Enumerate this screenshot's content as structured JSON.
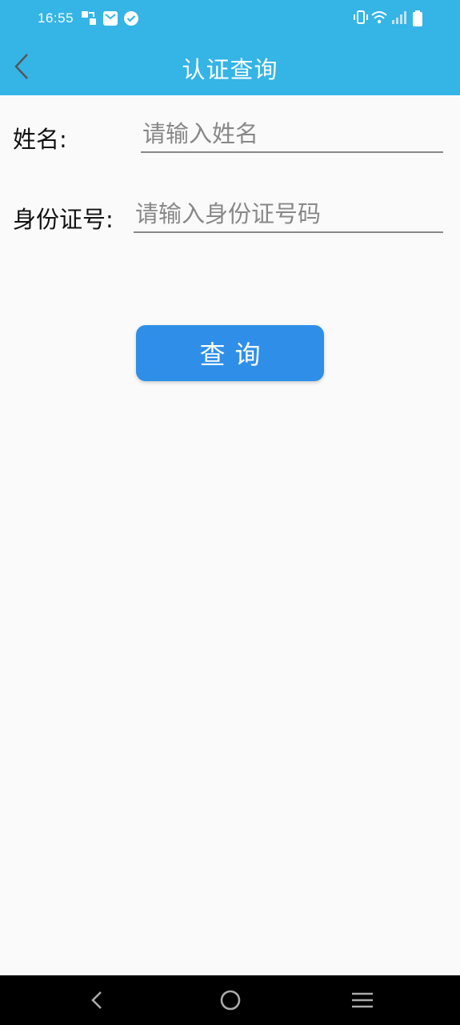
{
  "status_bar": {
    "time": "16:55",
    "icons": [
      "app-notification-icon",
      "mail-icon",
      "check-badge-icon",
      "vibrate-icon",
      "wifi-icon",
      "signal-icon",
      "battery-icon"
    ]
  },
  "header": {
    "title": "认证查询"
  },
  "form": {
    "name_label": "姓名:",
    "name_placeholder": "请输入姓名",
    "name_value": "",
    "id_label": "身份证号:",
    "id_placeholder": "请输入身份证号码",
    "id_value": ""
  },
  "query_button": {
    "label": "查询"
  },
  "colors": {
    "header_bg": "#35b4e6",
    "button_bg": "#2f8fe8",
    "page_bg": "#fafafa"
  }
}
